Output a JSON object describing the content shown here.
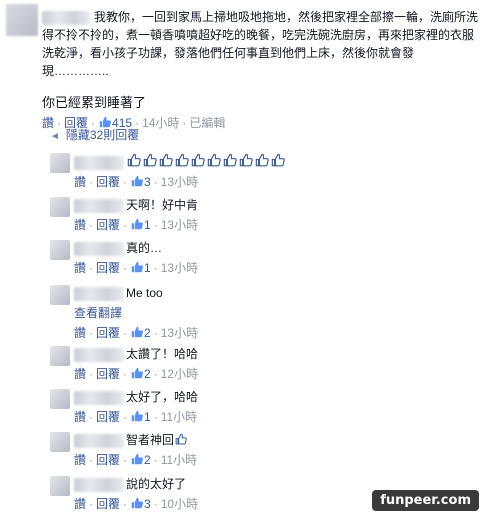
{
  "post": {
    "text": "我教你，一回到家馬上掃地吸地拖地，然後把家裡全部擦一輪，洗廁所洗得不拎不拎的，煮一頓香噴噴超好吃的晚餐，吃完洗碗洗廚房，再來把家裡的衣服洗乾淨，看小孩子功課，發落他們任何事直到他們上床，然後你就會發現…………..",
    "reply": "你已經累到睡著了",
    "actions": {
      "like": "讚",
      "reply": "回覆",
      "like_count": "415",
      "time": "14小時",
      "edited": "已編輯"
    }
  },
  "hidden_replies": {
    "label": "隱藏32則回覆"
  },
  "replies": [
    {
      "text": "",
      "emoji_count": 10,
      "like": "讚",
      "reply": "回覆",
      "likes": "3",
      "time": "13小時"
    },
    {
      "text": "天啊！好中肯",
      "like": "讚",
      "reply": "回覆",
      "likes": "1",
      "time": "13小時"
    },
    {
      "text": "真的…",
      "like": "讚",
      "reply": "回覆",
      "likes": "1",
      "time": "13小時"
    },
    {
      "text": "Me too",
      "translate": "查看翻譯",
      "like": "讚",
      "reply": "回覆",
      "likes": "2",
      "time": "13小時"
    },
    {
      "text": "太讚了！哈哈",
      "like": "讚",
      "reply": "回覆",
      "likes": "2",
      "time": "12小時"
    },
    {
      "text": "太好了，哈哈",
      "like": "讚",
      "reply": "回覆",
      "likes": "1",
      "time": "11小時"
    },
    {
      "text": "智者神回",
      "like": "讚",
      "reply": "回覆",
      "likes": "2",
      "time": "11小時"
    },
    {
      "text": "說的太好了",
      "like": "讚",
      "reply": "回覆",
      "likes": "3",
      "time": "10小時"
    }
  ],
  "watermark": "funpeer.com",
  "icons": {
    "like_thumb": "thumbs-up-icon",
    "collapse_arrow": "arrow-icon"
  },
  "colors": {
    "link": "#3b5998",
    "muted": "#9197a3",
    "text": "#141823"
  }
}
